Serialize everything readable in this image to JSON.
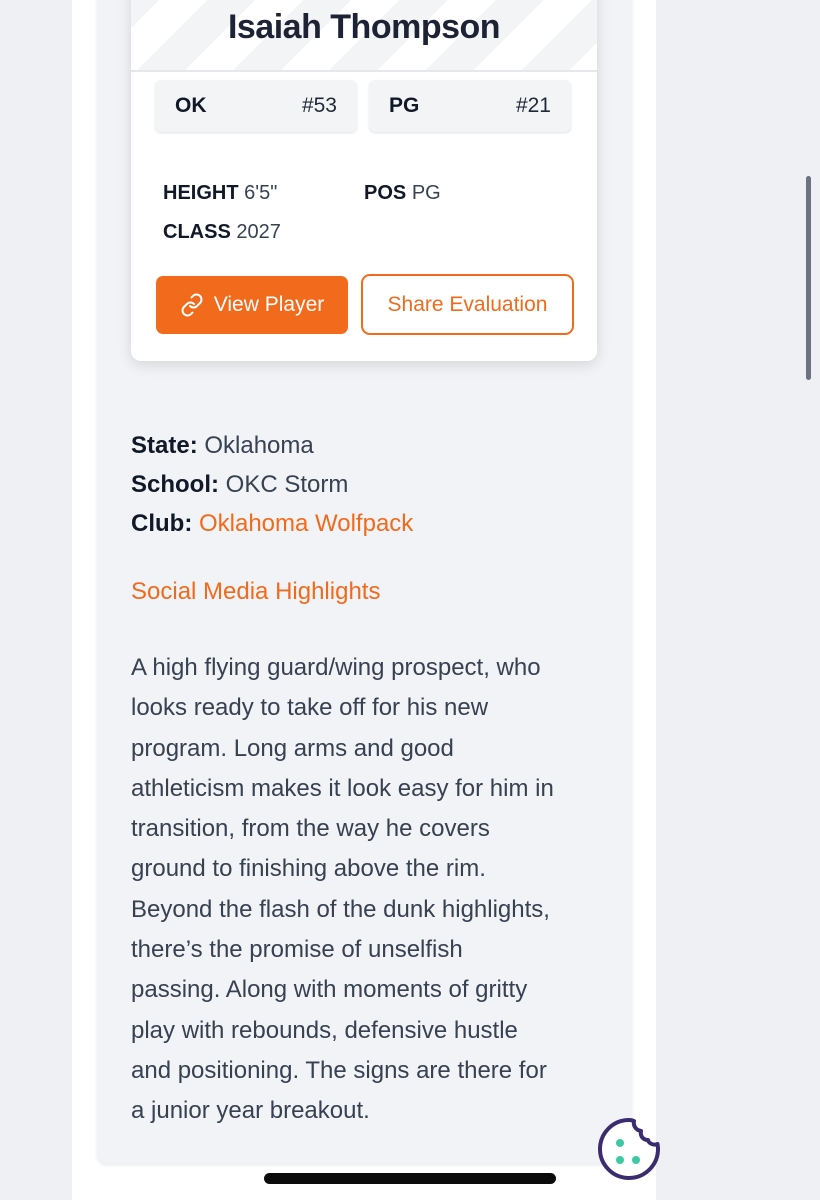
{
  "player": {
    "name": "Isaiah Thompson",
    "chips": [
      {
        "label": "OK",
        "value": "#53"
      },
      {
        "label": "PG",
        "value": "#21"
      }
    ],
    "stats": {
      "height_label": "HEIGHT",
      "height_value": "6'5\"",
      "pos_label": "POS",
      "pos_value": "PG",
      "class_label": "CLASS",
      "class_value": "2027"
    },
    "buttons": {
      "view_player": "View Player",
      "share_evaluation": "Share Evaluation"
    }
  },
  "info": {
    "state_label": "State:",
    "state_value": "Oklahoma",
    "school_label": "School:",
    "school_value": "OKC Storm",
    "club_label": "Club:",
    "club_value": "Oklahoma Wolfpack"
  },
  "social_link": "Social Media Highlights",
  "bio_lines": [
    "A high flying guard/wing prospect, who",
    "looks ready to take off for his new",
    "program. Long arms and good",
    "athleticism makes it look easy for him in",
    "transition, from the way he covers",
    "ground to finishing above the rim.",
    "Beyond the flash of the dunk highlights,",
    "there’s the promise of unselfish",
    "passing. Along with moments of gritty",
    "play with rebounds, defensive hustle",
    "and positioning. The signs are there for",
    "a junior year breakout."
  ],
  "icons": {
    "view_player": "link-icon",
    "cookie": "cookie-icon"
  },
  "colors": {
    "accent": "#f26a1b",
    "name": "#1e2235",
    "cookie_icon": "#3b2c6e",
    "cookie_dots": "#3cc9a3"
  }
}
